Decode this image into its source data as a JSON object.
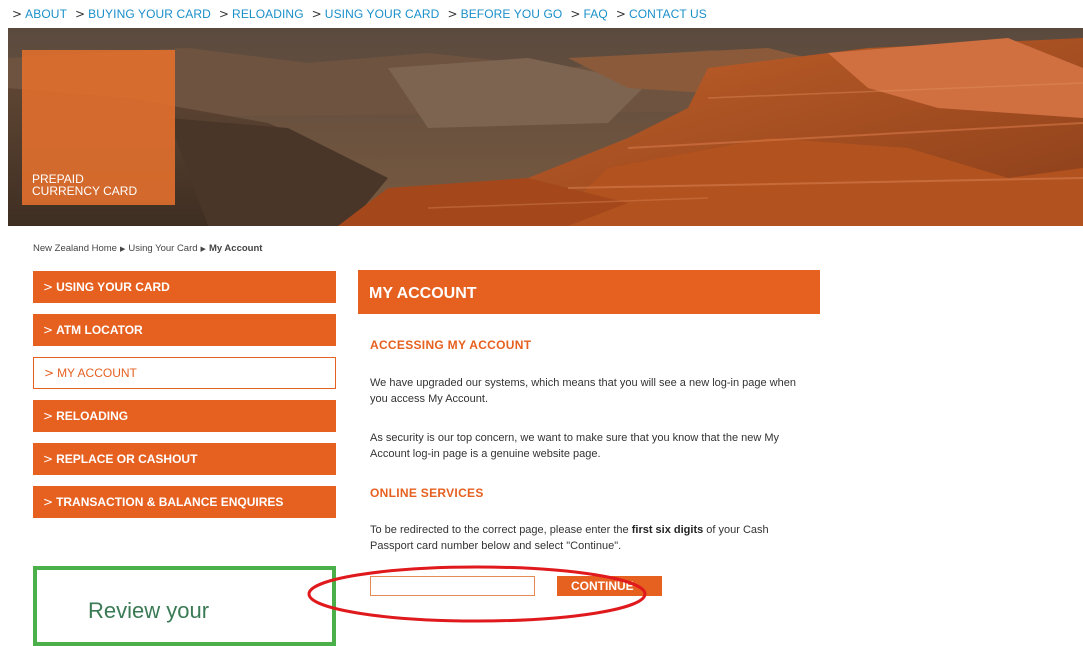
{
  "topnav": {
    "items": [
      {
        "label": "ABOUT"
      },
      {
        "label": "BUYING YOUR CARD"
      },
      {
        "label": "RELOADING"
      },
      {
        "label": "USING YOUR CARD"
      },
      {
        "label": "BEFORE YOU GO"
      },
      {
        "label": "FAQ"
      },
      {
        "label": "CONTACT US"
      }
    ]
  },
  "banner": {
    "card_label": "PREPAID\nCURRENCY CARD"
  },
  "breadcrumb": {
    "items": [
      "New Zealand Home",
      "Using Your Card",
      "My Account"
    ]
  },
  "sidebar": {
    "items": [
      {
        "label": "USING YOUR CARD",
        "active": false
      },
      {
        "label": "ATM LOCATOR",
        "active": false
      },
      {
        "label": "MY ACCOUNT",
        "active": true
      },
      {
        "label": "RELOADING",
        "active": false
      },
      {
        "label": "REPLACE OR CASHOUT",
        "active": false
      },
      {
        "label": "TRANSACTION & BALANCE ENQUIRES",
        "active": false
      }
    ],
    "promo_text": "Review your"
  },
  "main": {
    "title": "MY ACCOUNT",
    "heading_access": "ACCESSING MY ACCOUNT",
    "para1": "We have upgraded our systems, which means that you will see a new log-in page when you access My Account.",
    "para2": "As security is our top concern, we want to make sure that you know that the new My Account log-in page is a genuine website page.",
    "heading_online": "ONLINE SERVICES",
    "para3_before": "To be redirected to the correct page, please enter the ",
    "para3_bold": "first six digits",
    "para3_after": " of your Cash Passport card number below and select \"Continue\".",
    "input_value": "",
    "continue_label": "CONTINUE"
  },
  "colors": {
    "accent": "#e66020",
    "link": "#1a8fc9",
    "promo_border": "#4cb04a",
    "annotation": "#e0191c"
  },
  "icons": {
    "nav_chevron": "chevron-right-icon",
    "breadcrumb_separator": "triangle-right-icon"
  }
}
